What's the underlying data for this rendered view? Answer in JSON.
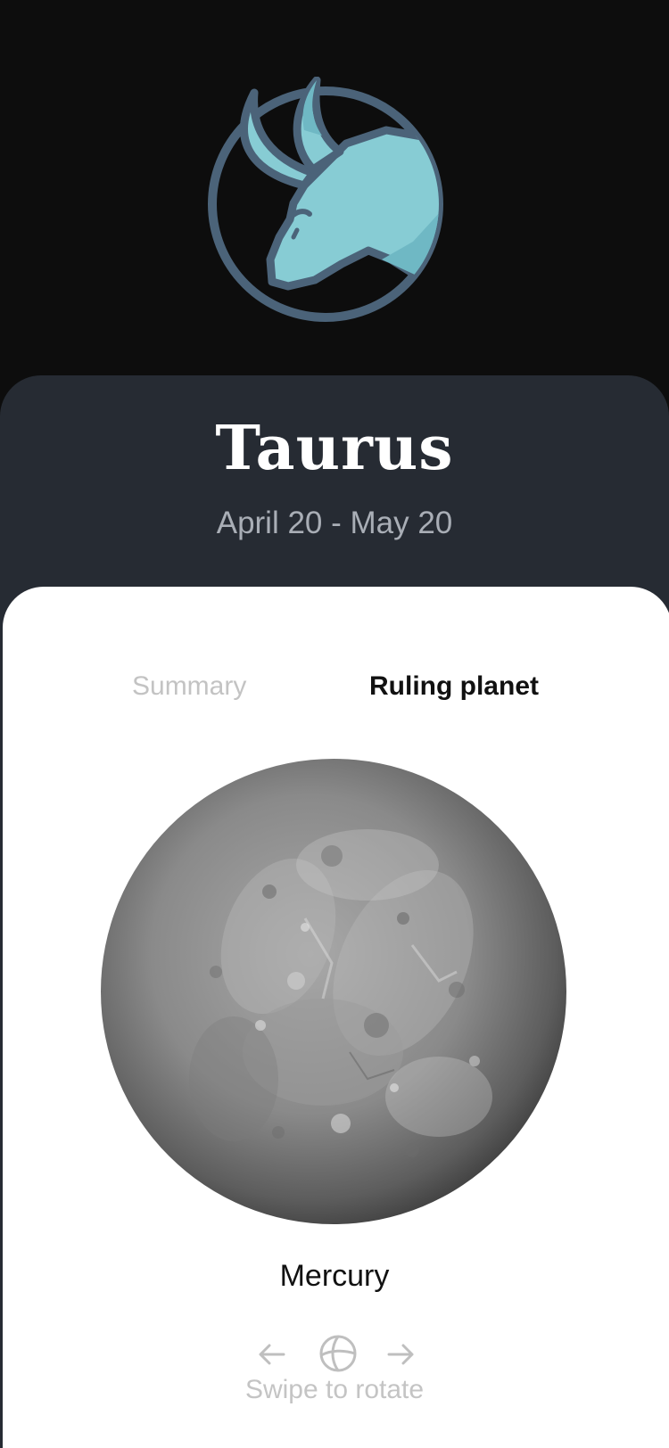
{
  "sign": {
    "name": "Taurus",
    "dates": "April 20 - May 20",
    "emblem_icon": "taurus-bull-icon"
  },
  "tabs": [
    {
      "label": "Summary",
      "active": false
    },
    {
      "label": "Ruling planet",
      "active": true
    }
  ],
  "planet": {
    "name": "Mercury",
    "image": "mercury-globe"
  },
  "rotate": {
    "hint": "Swipe to rotate",
    "left_icon": "arrow-left-icon",
    "globe_icon": "globe-icon",
    "right_icon": "arrow-right-icon"
  },
  "colors": {
    "background": "#0d0d0d",
    "card": "#262b33",
    "sheet": "#ffffff",
    "emblem_fill": "#87ccd4",
    "emblem_outline": "#4b6379",
    "inactive_tab": "#c3c3c3"
  }
}
